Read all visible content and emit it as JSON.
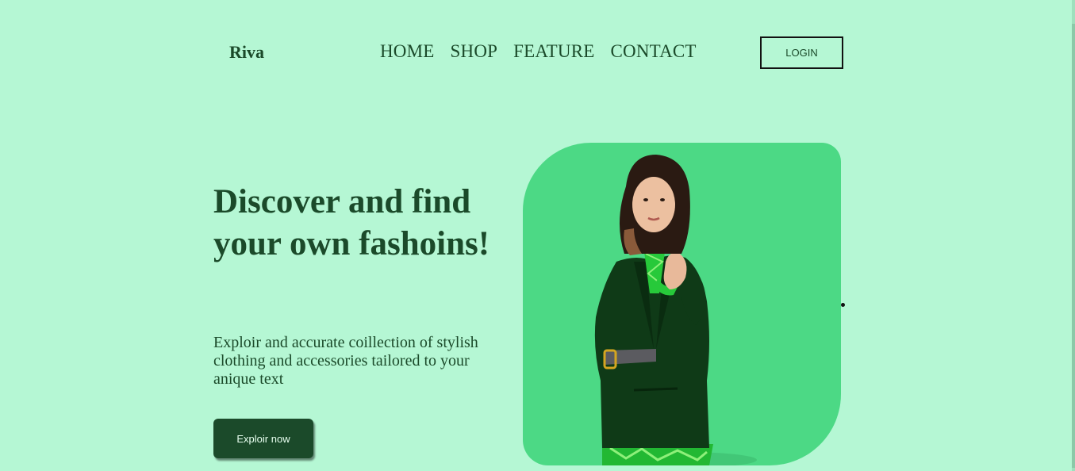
{
  "header": {
    "logo": "Riva",
    "nav": [
      "HOME",
      "SHOP",
      "FEATURE",
      "CONTACT"
    ],
    "login_label": "LOGIN"
  },
  "hero": {
    "title": "Discover and find your own fashoins!",
    "description": "Exploir and accurate coillection of stylish clothing and accessories tailored to your anique text",
    "cta_label": "Exploir now"
  },
  "colors": {
    "background": "#b5f7d4",
    "card": "#4cd985",
    "primary": "#1b4a2a"
  }
}
